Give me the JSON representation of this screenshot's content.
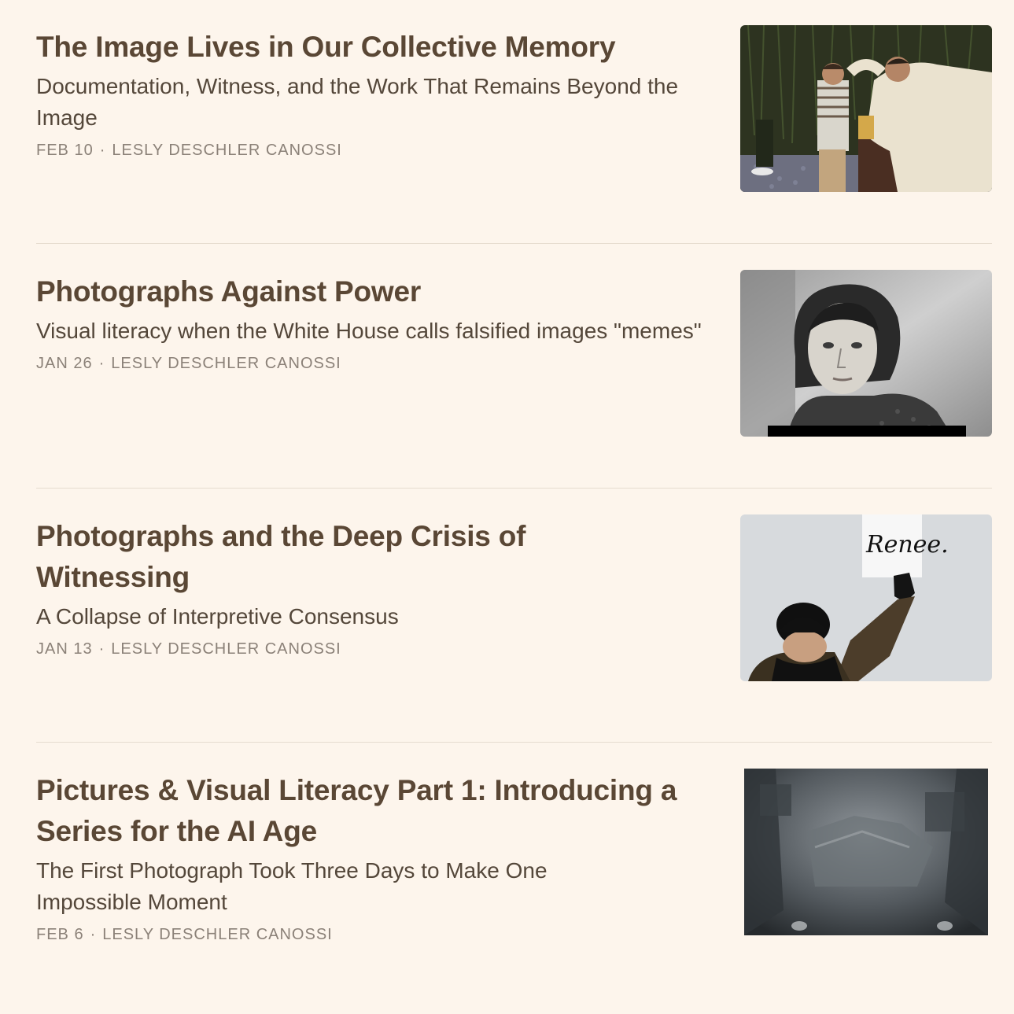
{
  "posts": [
    {
      "title": "The Image Lives in Our Collective Memory",
      "subtitle": "Documentation, Witness, and the Work That Remains Beyond the Image",
      "date": "FEB 10",
      "author": "LESLY DESCHLER CANOSSI",
      "thumbnail_icon": "photo-man-blessing-boy"
    },
    {
      "title": "Photographs Against Power",
      "subtitle": "Visual literacy when the White House calls falsified images \"memes\"",
      "date": "JAN 26",
      "author": "LESLY DESCHLER CANOSSI",
      "thumbnail_icon": "photo-bw-portrait-woman"
    },
    {
      "title": "Photographs and the Deep Crisis of Witnessing",
      "subtitle": "A Collapse of Interpretive Consensus",
      "date": "JAN 13",
      "author": "LESLY DESCHLER CANOSSI",
      "thumbnail_icon": "photo-protester-sign",
      "thumbnail_sign_text": "Renee."
    },
    {
      "title": "Pictures & Visual Literacy Part 1: Introducing a Series for the AI Age",
      "subtitle": "The First Photograph Took Three Days to Make One Impossible Moment",
      "date": "FEB 6",
      "author": "LESLY DESCHLER CANOSSI",
      "thumbnail_icon": "photo-first-photograph"
    }
  ],
  "meta_separator": "·",
  "colors": {
    "background": "#fdf5ec",
    "title": "#5a4735",
    "subtitle": "#54473a",
    "meta": "#8b8178",
    "divider": "#e6dccf"
  }
}
